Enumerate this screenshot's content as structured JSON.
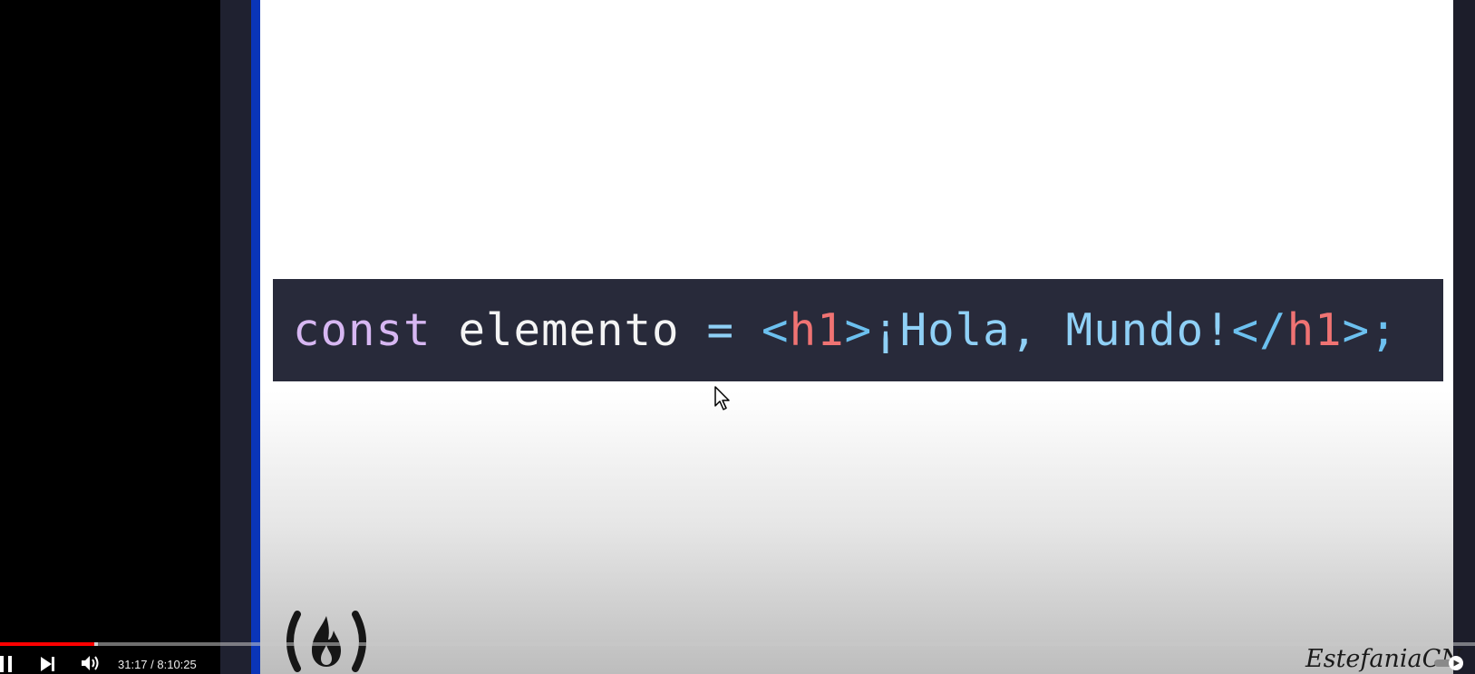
{
  "slide": {
    "code_tokens": [
      {
        "text": "const",
        "cls": "tok-kw"
      },
      {
        "text": " ",
        "cls": "sp"
      },
      {
        "text": "elemento",
        "cls": "tok-id"
      },
      {
        "text": " ",
        "cls": "sp"
      },
      {
        "text": "=",
        "cls": "tok-op"
      },
      {
        "text": " ",
        "cls": "sp"
      },
      {
        "text": "<",
        "cls": "tok-br"
      },
      {
        "text": "h1",
        "cls": "tok-tag"
      },
      {
        "text": ">",
        "cls": "tok-br"
      },
      {
        "text": "¡Hola, Mundo!",
        "cls": "tok-str"
      },
      {
        "text": "</",
        "cls": "tok-br"
      },
      {
        "text": "h1",
        "cls": "tok-tag"
      },
      {
        "text": ">;",
        "cls": "tok-br"
      }
    ]
  },
  "watermark": "EstefaniaCN",
  "player": {
    "time_display": "31:17 / 8:10:25",
    "progress_fraction": 0.0638,
    "icons": {
      "pause": "pause-icon",
      "next": "next-icon",
      "volume": "volume-icon",
      "autoplay": "autoplay-toggle-icon"
    },
    "colors": {
      "played": "#ff0000"
    }
  }
}
